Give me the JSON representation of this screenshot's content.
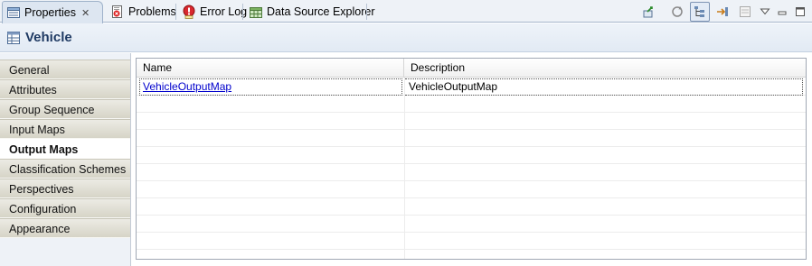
{
  "tabs": [
    {
      "label": "Properties",
      "icon": "properties-icon",
      "active": true,
      "closable": true
    },
    {
      "label": "Problems",
      "icon": "problems-icon",
      "active": false
    },
    {
      "label": "Error Log",
      "icon": "error-log-icon",
      "active": false
    },
    {
      "label": "Data Source Explorer",
      "icon": "data-source-explorer-icon",
      "active": false
    }
  ],
  "tab_close_glyph": "✕",
  "toolbar": [
    "pin-icon",
    "refresh-icon",
    "tree-layout-icon",
    "expand-icon",
    "filter-icon",
    "view-menu-icon",
    "minimize-icon",
    "maximize-icon"
  ],
  "header": {
    "title": "Vehicle",
    "icon": "table-icon"
  },
  "nav": {
    "items": [
      {
        "label": "General"
      },
      {
        "label": "Attributes"
      },
      {
        "label": "Group Sequence"
      },
      {
        "label": "Input Maps"
      },
      {
        "label": "Output Maps",
        "selected": true
      },
      {
        "label": "Classification Schemes"
      },
      {
        "label": "Perspectives"
      },
      {
        "label": "Configuration"
      },
      {
        "label": "Appearance"
      }
    ]
  },
  "table": {
    "columns": [
      "Name",
      "Description"
    ],
    "rows": [
      {
        "name": "VehicleOutputMap",
        "description": "VehicleOutputMap"
      }
    ]
  },
  "colors": {
    "accent_title": "#1f3a63",
    "link": "#0000cc",
    "tab_active_bg": "#dde6f1"
  }
}
